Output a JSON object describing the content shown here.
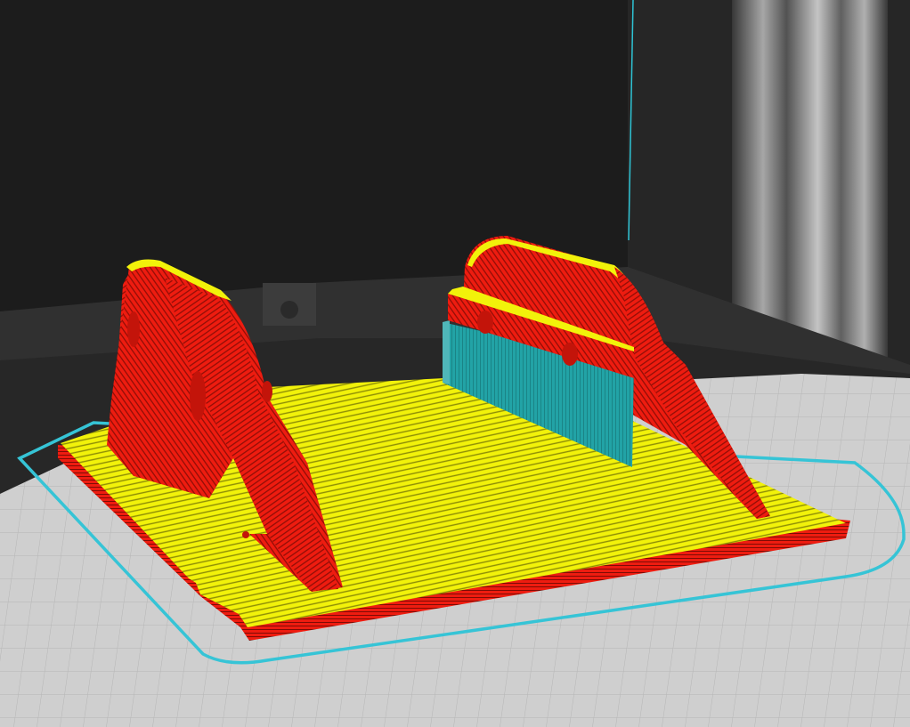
{
  "viewport": {
    "view": "3d-slice-preview"
  },
  "colors": {
    "background": "#1c1c1c",
    "wall": "#262626",
    "floor": "#3a3a3a",
    "bed": "#cfcfcf",
    "bed_grid": "#b3b3b3",
    "skirt": "#36c4d6",
    "top_surface": "#f2f20a",
    "perimeter": "#ee1c10",
    "support": "#22a3a6",
    "ceiling_light": "#d9d9d9",
    "axis_line": "#2ec3d4"
  },
  "layers": [
    {
      "name": "skirt",
      "icon": "skirt-outline"
    },
    {
      "name": "top-surface",
      "icon": "infill-lines"
    },
    {
      "name": "perimeter",
      "icon": "wall-lines"
    },
    {
      "name": "support",
      "icon": "support-block"
    }
  ]
}
